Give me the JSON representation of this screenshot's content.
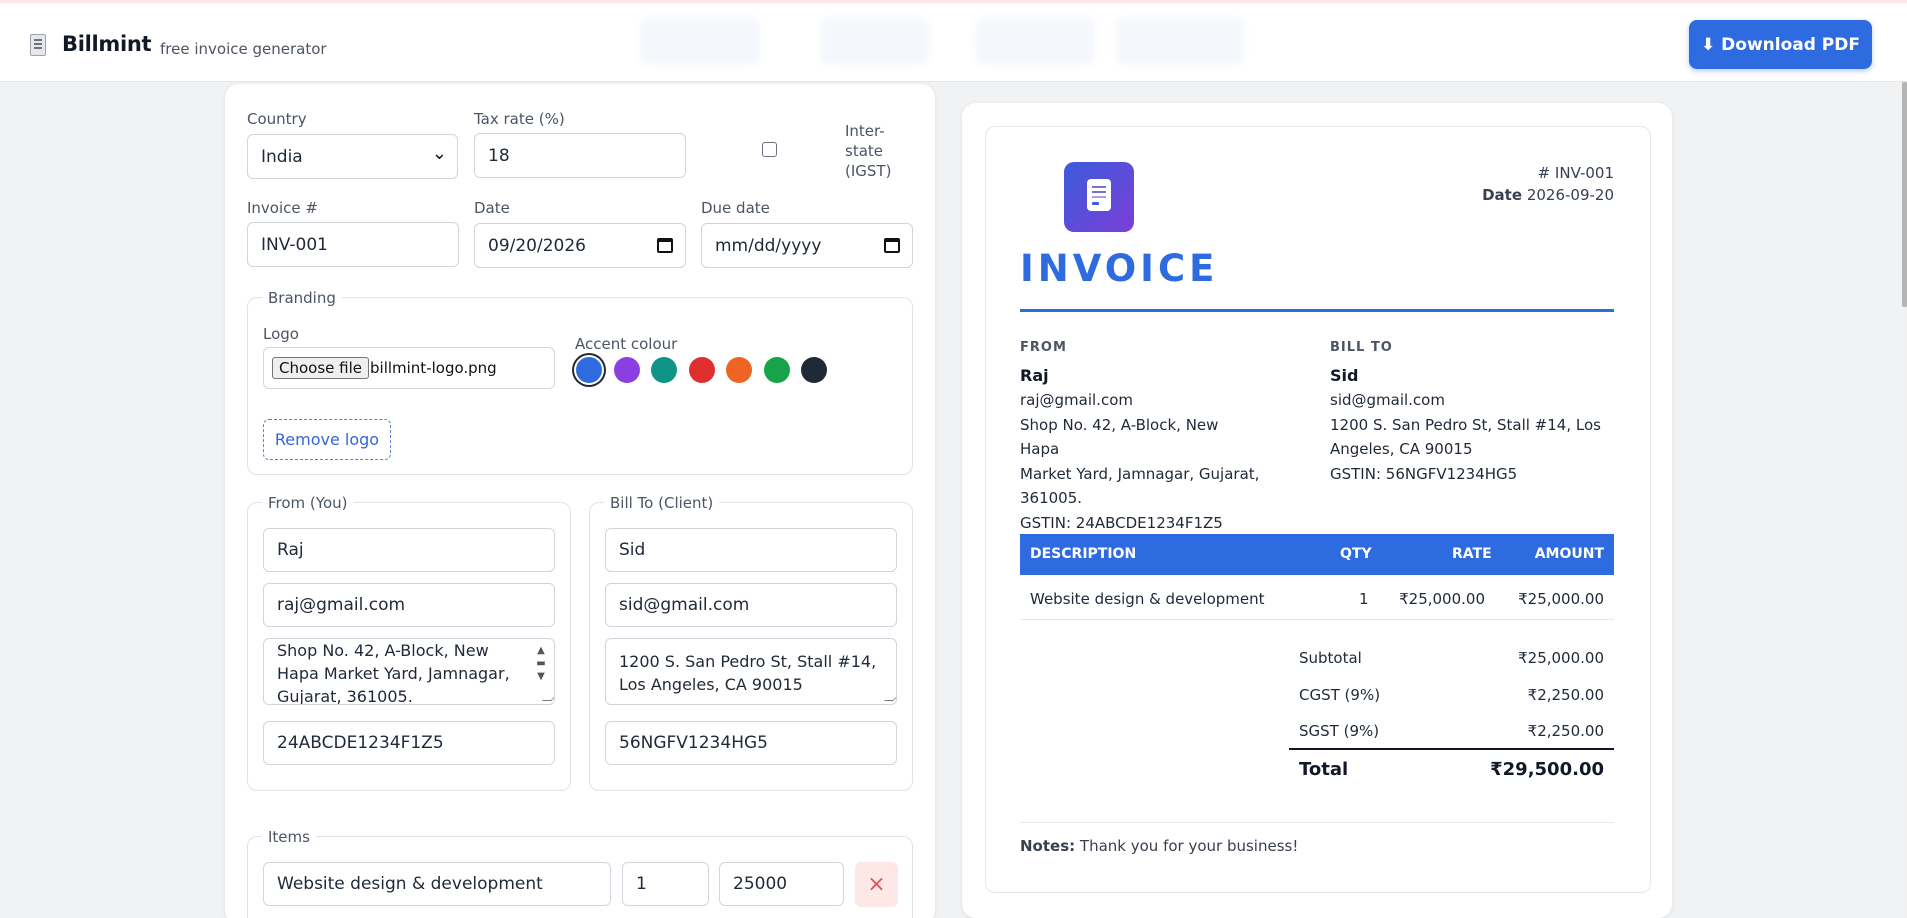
{
  "header": {
    "brand_name": "Billmint",
    "tagline": "free invoice generator",
    "download_label": "⬇ Download PDF"
  },
  "form": {
    "country_label": "Country",
    "country_value": "India",
    "tax_rate_label": "Tax rate (%)",
    "tax_rate_value": "18",
    "interstate_label_1": "Inter-",
    "interstate_label_2": "state",
    "interstate_label_3": "(IGST)",
    "interstate_checked": false,
    "invoice_no_label": "Invoice #",
    "invoice_no_value": "INV-001",
    "date_label": "Date",
    "date_value": "09/20/2026",
    "due_date_label": "Due date",
    "due_date_placeholder": "mm/dd/yyyy",
    "branding": {
      "legend": "Branding",
      "logo_label": "Logo",
      "choose_file_label": "Choose file",
      "file_name": "billmint-logo.png",
      "accent_label": "Accent colour",
      "accent_colors": [
        "#2f6be0",
        "#8b3fe0",
        "#0f9488",
        "#e02e2e",
        "#ee6422",
        "#16a34a",
        "#1f2937"
      ],
      "selected_accent": "#2f6be0",
      "remove_logo_label": "Remove logo"
    },
    "from": {
      "legend": "From (You)",
      "name": "Raj",
      "email": "raj@gmail.com",
      "address_lines": [
        "Shop No. 42, A-Block, New",
        "Hapa Market Yard, Jamnagar,",
        "Gujarat, 361005."
      ],
      "gstin": "24ABCDE1234F1Z5"
    },
    "bill_to": {
      "legend": "Bill To (Client)",
      "name": "Sid",
      "email": "sid@gmail.com",
      "address_lines": [
        "1200 S. San Pedro St, Stall #14,",
        "Los Angeles, CA 90015"
      ],
      "gstin": "56NGFV1234HG5"
    },
    "items": {
      "legend": "Items",
      "rows": [
        {
          "description": "Website design & development",
          "qty": "1",
          "rate": "25000"
        }
      ],
      "delete_icon": "×"
    }
  },
  "invoice": {
    "number_text": "# INV-001",
    "date_label": "Date",
    "date_value": "2026-09-20",
    "title": "INVOICE",
    "from_heading": "FROM",
    "bill_to_heading": "BILL TO",
    "from": {
      "name": "Raj",
      "lines": [
        "raj@gmail.com",
        "Shop No. 42, A-Block, New Hapa",
        "Market Yard, Jamnagar, Gujarat,",
        "361005.",
        "GSTIN: 24ABCDE1234F1Z5"
      ]
    },
    "bill_to": {
      "name": "Sid",
      "lines": [
        "sid@gmail.com",
        "1200 S. San Pedro St, Stall #14, Los",
        "Angeles, CA 90015",
        "GSTIN: 56NGFV1234HG5"
      ]
    },
    "columns": {
      "description": "DESCRIPTION",
      "qty": "QTY",
      "rate": "RATE",
      "amount": "AMOUNT"
    },
    "line_items": [
      {
        "description": "Website design & development",
        "qty": "1",
        "rate": "₹25,000.00",
        "amount": "₹25,000.00"
      }
    ],
    "totals": {
      "subtotal_label": "Subtotal",
      "subtotal_value": "₹25,000.00",
      "cgst_label": "CGST (9%)",
      "cgst_value": "₹2,250.00",
      "sgst_label": "SGST (9%)",
      "sgst_value": "₹2,250.00",
      "total_label": "Total",
      "total_value": "₹29,500.00"
    },
    "notes_label": "Notes:",
    "notes_text": "Thank you for your business!"
  }
}
